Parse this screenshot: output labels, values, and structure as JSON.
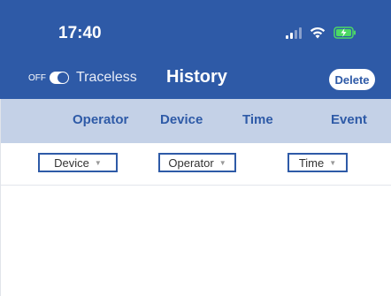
{
  "status_bar": {
    "time": "17:40",
    "icons": [
      "signal-icon",
      "wifi-icon",
      "battery-charging-icon"
    ]
  },
  "header": {
    "toggle_state": "OFF",
    "toggle_label": "Traceless",
    "title": "History",
    "delete_label": "Delete"
  },
  "columns": [
    "Operator",
    "Device",
    "Time",
    "Event"
  ],
  "filters": {
    "device": "Device",
    "operator": "Operator",
    "time": "Time"
  },
  "colors": {
    "header_bg": "#2e5aa7",
    "column_bar_bg": "#c4d1e7",
    "accent": "#2e5aa7",
    "battery": "#4cd964"
  }
}
